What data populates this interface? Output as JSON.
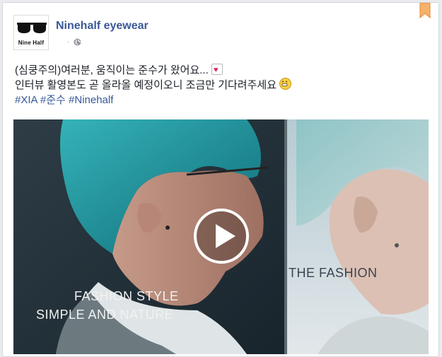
{
  "post": {
    "page_name": "Ninehalf eyewear",
    "avatar_text": "Nine Half",
    "meta_dot": "·",
    "text_line1": "(심쿵주의)여러분, 움직이는 준수가 왔어요...",
    "text_line2": "인터뷰 활영본도 곧 올라올 예정이오니 조금만 기다려주세요",
    "hashtags": [
      "#XIA",
      "#준수",
      "#Ninehalf"
    ]
  },
  "video": {
    "caption_1": "FASHION STYLE",
    "caption_2": "SIMPLE AND NATURE",
    "caption_3": "THE FASHION"
  },
  "icons": {
    "bookmark": "bookmark-icon",
    "globe": "globe-icon",
    "heart": "heart-emoji-icon",
    "smile": "smile-emoji-icon",
    "play": "play-icon"
  },
  "colors": {
    "link": "#3b5998",
    "hashtag": "#365899",
    "bookmark": "#f5a623"
  }
}
